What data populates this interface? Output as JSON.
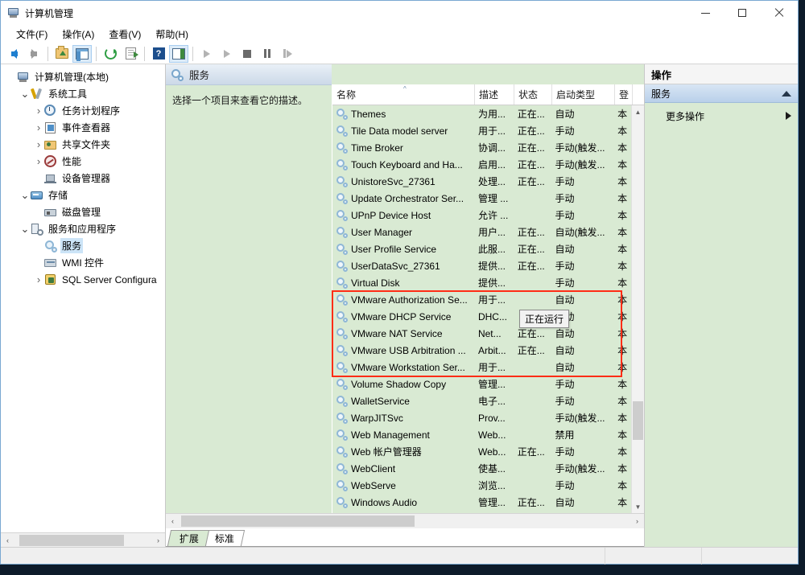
{
  "window": {
    "title": "计算机管理",
    "icon": "computer-management-icon",
    "minimize": "–",
    "maximize": "□",
    "close": "✕"
  },
  "menu": [
    {
      "label": "文件(F)",
      "name": "menu-file"
    },
    {
      "label": "操作(A)",
      "name": "menu-action"
    },
    {
      "label": "查看(V)",
      "name": "menu-view"
    },
    {
      "label": "帮助(H)",
      "name": "menu-help"
    }
  ],
  "toolbar": [
    {
      "name": "back-icon",
      "label": "后退"
    },
    {
      "name": "forward-icon",
      "label": "前进"
    },
    {
      "name": "up-folder-icon",
      "label": "向上"
    },
    {
      "name": "show-hide-tree-icon",
      "label": "显示/隐藏控制台树"
    },
    {
      "name": "refresh-icon",
      "label": "刷新"
    },
    {
      "name": "export-list-icon",
      "label": "导出列表"
    },
    {
      "name": "help-icon",
      "label": "帮助"
    },
    {
      "name": "properties-icon",
      "label": "属性"
    },
    {
      "name": "start-service-icon",
      "label": "启动服务"
    },
    {
      "name": "resume-service-icon",
      "label": "继续服务"
    },
    {
      "name": "stop-service-icon",
      "label": "停止服务"
    },
    {
      "name": "pause-service-icon",
      "label": "暂停服务"
    },
    {
      "name": "restart-service-icon",
      "label": "重启服务"
    }
  ],
  "tree": [
    {
      "label": "计算机管理(本地)",
      "icon": "computer-icon",
      "indent": 0,
      "chevron": "",
      "selected": false
    },
    {
      "label": "系统工具",
      "icon": "system-tools-icon",
      "indent": 1,
      "chevron": "down",
      "selected": false
    },
    {
      "label": "任务计划程序",
      "icon": "task-scheduler-icon",
      "indent": 2,
      "chevron": "right",
      "selected": false
    },
    {
      "label": "事件查看器",
      "icon": "event-viewer-icon",
      "indent": 2,
      "chevron": "right",
      "selected": false
    },
    {
      "label": "共享文件夹",
      "icon": "shared-folders-icon",
      "indent": 2,
      "chevron": "right",
      "selected": false
    },
    {
      "label": "性能",
      "icon": "performance-icon",
      "indent": 2,
      "chevron": "right",
      "selected": false
    },
    {
      "label": "设备管理器",
      "icon": "device-manager-icon",
      "indent": 2,
      "chevron": "",
      "selected": false
    },
    {
      "label": "存储",
      "icon": "storage-icon",
      "indent": 1,
      "chevron": "down",
      "selected": false
    },
    {
      "label": "磁盘管理",
      "icon": "disk-management-icon",
      "indent": 2,
      "chevron": "",
      "selected": false
    },
    {
      "label": "服务和应用程序",
      "icon": "services-applications-icon",
      "indent": 1,
      "chevron": "down",
      "selected": false
    },
    {
      "label": "服务",
      "icon": "services-icon",
      "indent": 2,
      "chevron": "",
      "selected": true
    },
    {
      "label": "WMI 控件",
      "icon": "wmi-control-icon",
      "indent": 2,
      "chevron": "",
      "selected": false
    },
    {
      "label": "SQL Server Configura",
      "icon": "sql-server-config-icon",
      "indent": 2,
      "chevron": "right",
      "selected": false
    }
  ],
  "detail": {
    "header_title": "服务",
    "header_icon": "services-icon",
    "description": "选择一个项目来查看它的描述。"
  },
  "list": {
    "columns": [
      {
        "key": "name",
        "label": "名称",
        "sorted": true,
        "sort_glyph": "^"
      },
      {
        "key": "description",
        "label": "描述"
      },
      {
        "key": "status",
        "label": "状态"
      },
      {
        "key": "startup",
        "label": "启动类型"
      },
      {
        "key": "logon",
        "label": "登"
      }
    ],
    "rows": [
      {
        "name": "Themes",
        "description": "为用...",
        "status": "正在...",
        "startup": "自动",
        "logon": "本"
      },
      {
        "name": "Tile Data model server",
        "description": "用于...",
        "status": "正在...",
        "startup": "手动",
        "logon": "本"
      },
      {
        "name": "Time Broker",
        "description": "协调...",
        "status": "正在...",
        "startup": "手动(触发...",
        "logon": "本"
      },
      {
        "name": "Touch Keyboard and Ha...",
        "description": "启用...",
        "status": "正在...",
        "startup": "手动(触发...",
        "logon": "本"
      },
      {
        "name": "UnistoreSvc_27361",
        "description": "处理...",
        "status": "正在...",
        "startup": "手动",
        "logon": "本"
      },
      {
        "name": "Update Orchestrator Ser...",
        "description": "管理 ...",
        "status": "",
        "startup": "手动",
        "logon": "本"
      },
      {
        "name": "UPnP Device Host",
        "description": "允许 ...",
        "status": "",
        "startup": "手动",
        "logon": "本"
      },
      {
        "name": "User Manager",
        "description": "用户...",
        "status": "正在...",
        "startup": "自动(触发...",
        "logon": "本"
      },
      {
        "name": "User Profile Service",
        "description": "此服...",
        "status": "正在...",
        "startup": "自动",
        "logon": "本"
      },
      {
        "name": "UserDataSvc_27361",
        "description": "提供...",
        "status": "正在...",
        "startup": "手动",
        "logon": "本"
      },
      {
        "name": "Virtual Disk",
        "description": "提供...",
        "status": "",
        "startup": "手动",
        "logon": "本"
      },
      {
        "name": "VMware Authorization Se...",
        "description": "用于...",
        "status": "",
        "startup": "自动",
        "logon": "本",
        "highlighted": true
      },
      {
        "name": "VMware DHCP Service",
        "description": "DHC...",
        "status": "",
        "startup": "自动",
        "logon": "本",
        "highlighted": true
      },
      {
        "name": "VMware NAT Service",
        "description": "Net...",
        "status": "正在...",
        "startup": "自动",
        "logon": "本",
        "highlighted": true
      },
      {
        "name": "VMware USB Arbitration ...",
        "description": "Arbit...",
        "status": "正在...",
        "startup": "自动",
        "logon": "本",
        "highlighted": true
      },
      {
        "name": "VMware Workstation Ser...",
        "description": "用于...",
        "status": "",
        "startup": "自动",
        "logon": "本",
        "highlighted": true
      },
      {
        "name": "Volume Shadow Copy",
        "description": "管理...",
        "status": "",
        "startup": "手动",
        "logon": "本"
      },
      {
        "name": "WalletService",
        "description": "电子...",
        "status": "",
        "startup": "手动",
        "logon": "本"
      },
      {
        "name": "WarpJITSvc",
        "description": "Prov...",
        "status": "",
        "startup": "手动(触发...",
        "logon": "本"
      },
      {
        "name": "Web Management",
        "description": "Web...",
        "status": "",
        "startup": "禁用",
        "logon": "本"
      },
      {
        "name": "Web 帐户管理器",
        "description": "Web...",
        "status": "正在...",
        "startup": "手动",
        "logon": "本"
      },
      {
        "name": "WebClient",
        "description": "使基...",
        "status": "",
        "startup": "手动(触发...",
        "logon": "本"
      },
      {
        "name": "WebServe",
        "description": "浏览...",
        "status": "",
        "startup": "手动",
        "logon": "本"
      },
      {
        "name": "Windows Audio",
        "description": "管理...",
        "status": "正在...",
        "startup": "自动",
        "logon": "本"
      }
    ],
    "tooltip": "正在运行",
    "highlight_color": "#ff2d16"
  },
  "tabs": [
    {
      "label": "扩展",
      "active": true
    },
    {
      "label": "标准",
      "active": false
    }
  ],
  "actions": {
    "header": "操作",
    "section": "服务",
    "items": [
      {
        "label": "更多操作",
        "has_submenu": true
      }
    ]
  },
  "scrollbars": {
    "left_arrow": "‹",
    "right_arrow": "›",
    "up_arrow": "▲",
    "down_arrow": "▼"
  }
}
